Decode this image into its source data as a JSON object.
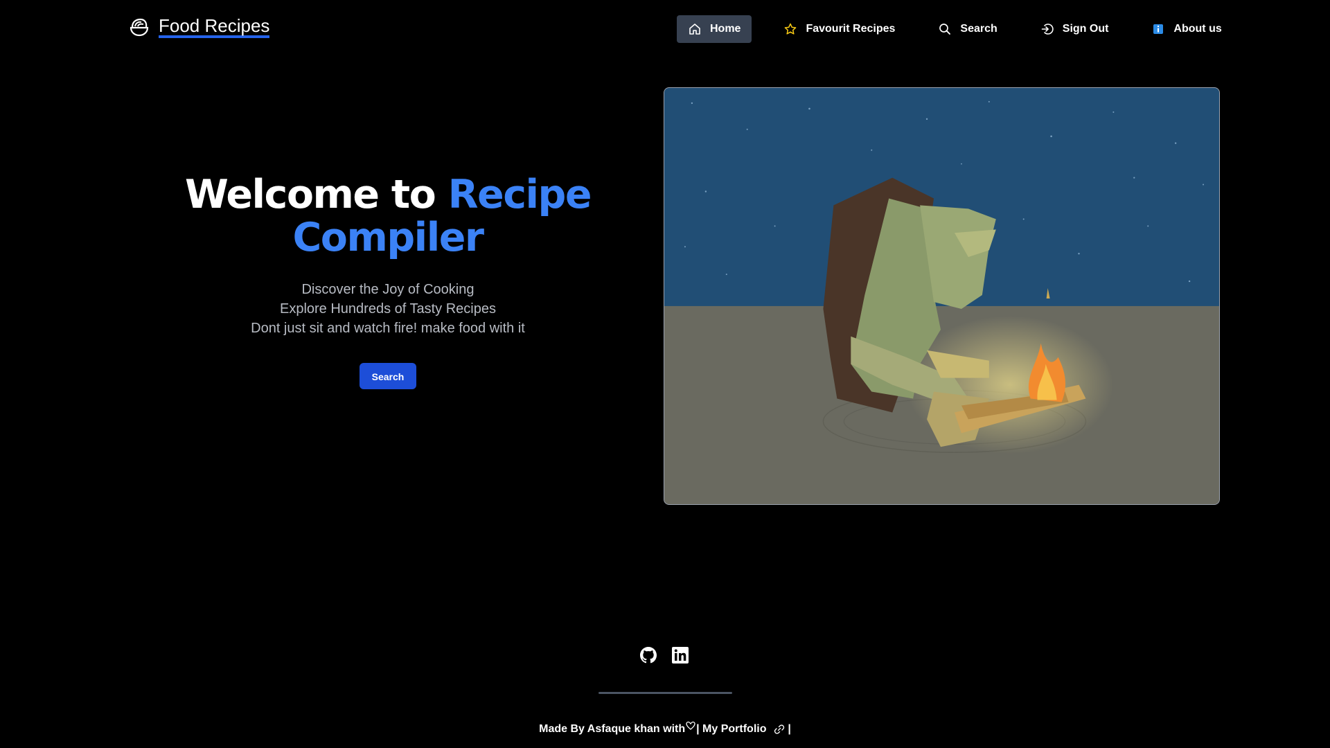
{
  "brand": {
    "name": "Food Recipes",
    "icon": "bowl-icon"
  },
  "nav": {
    "items": [
      {
        "label": "Home",
        "icon": "home-icon",
        "active": true
      },
      {
        "label": "Favourit Recipes",
        "icon": "star-icon",
        "active": false
      },
      {
        "label": "Search",
        "icon": "search-icon",
        "active": false
      },
      {
        "label": "Sign Out",
        "icon": "sign-out-icon",
        "active": false
      },
      {
        "label": "About us",
        "icon": "info-icon",
        "active": false
      }
    ]
  },
  "hero": {
    "title_prefix": "Welcome to ",
    "title_accent_1": "Recipe",
    "title_accent_2": "Compiler",
    "lines": [
      "Discover the Joy of Cooking",
      "Explore Hundreds of Tasty Recipes",
      "Dont just sit and watch fire! make food with it"
    ],
    "button_label": "Search",
    "image": "caveman-campfire-illustration"
  },
  "footer": {
    "social": [
      "github-icon",
      "linkedin-icon"
    ],
    "credit_prefix": "Made By Asfaque khan with",
    "credit_separator_1": "|",
    "portfolio_label": "My Portfolio",
    "credit_separator_2": "|"
  },
  "colors": {
    "background": "#000000",
    "accent": "#3b82f6",
    "button": "#1d4ed8",
    "active_nav": "#374151",
    "brand_underline": "#2563eb"
  }
}
